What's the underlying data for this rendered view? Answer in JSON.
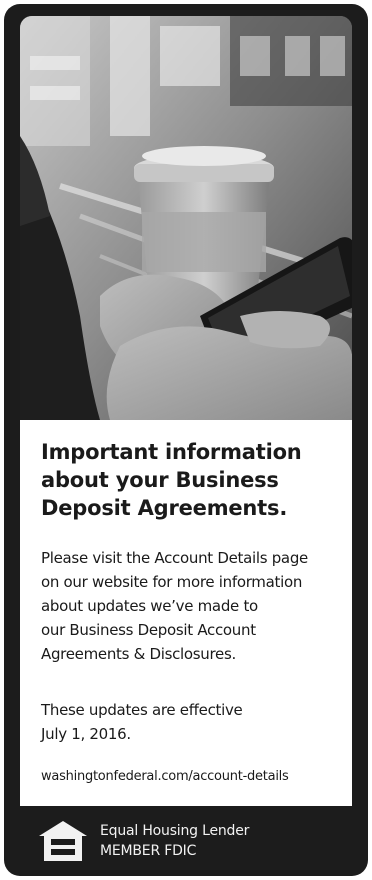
{
  "headline": "Important information\nabout your Business\nDeposit Agreements.",
  "headline_lines": [
    "Important information",
    "about your Business",
    "Deposit Agreements."
  ],
  "body_paragraph_1": "Please visit the Account Details page\non our website for more information\nabout updates we’ve made to\nour Business Deposit Account\nAgreements & Disclosures.",
  "body_paragraph_2": "These updates are effective\nJuly 1, 2016.",
  "url": "washingtonfederal.com/account-details",
  "footer": {
    "line_1": "Equal Housing Lender",
    "line_2": "MEMBER FDIC",
    "icon": "equal-housing-lender-icon"
  },
  "photo": {
    "subject": "hand-holding-coffee-cup-and-smartphone-photo"
  },
  "colors": {
    "frame": "#1c1c1c",
    "panel": "#ffffff",
    "text": "#1a1a1a",
    "footer_text": "#f2f2f2"
  }
}
